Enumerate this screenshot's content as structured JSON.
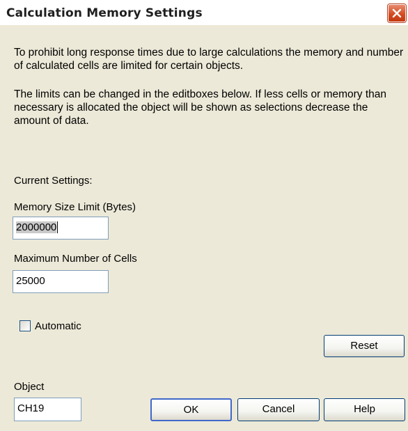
{
  "window": {
    "title": "Calculation Memory Settings"
  },
  "intro": {
    "paragraph1": "To prohibit long response times due to large calculations the memory and number of calculated cells are limited for certain objects.",
    "paragraph2": "The limits can be changed in the editboxes below. If less cells or memory than necessary is allocated the object will be shown as selections decrease the amount of data."
  },
  "settings": {
    "heading": "Current Settings:",
    "memory_label": "Memory Size Limit (Bytes)",
    "memory_value": "2000000",
    "cells_label": "Maximum Number of Cells",
    "cells_value": "25000",
    "automatic_label": "Automatic",
    "automatic_checked": false
  },
  "object": {
    "label": "Object",
    "value": "CH19"
  },
  "buttons": {
    "reset": "Reset",
    "ok": "OK",
    "cancel": "Cancel",
    "help": "Help"
  },
  "colors": {
    "close_button": "#d2491f",
    "dialog_bg": "#ece9d8",
    "field_border": "#7f9db9"
  }
}
